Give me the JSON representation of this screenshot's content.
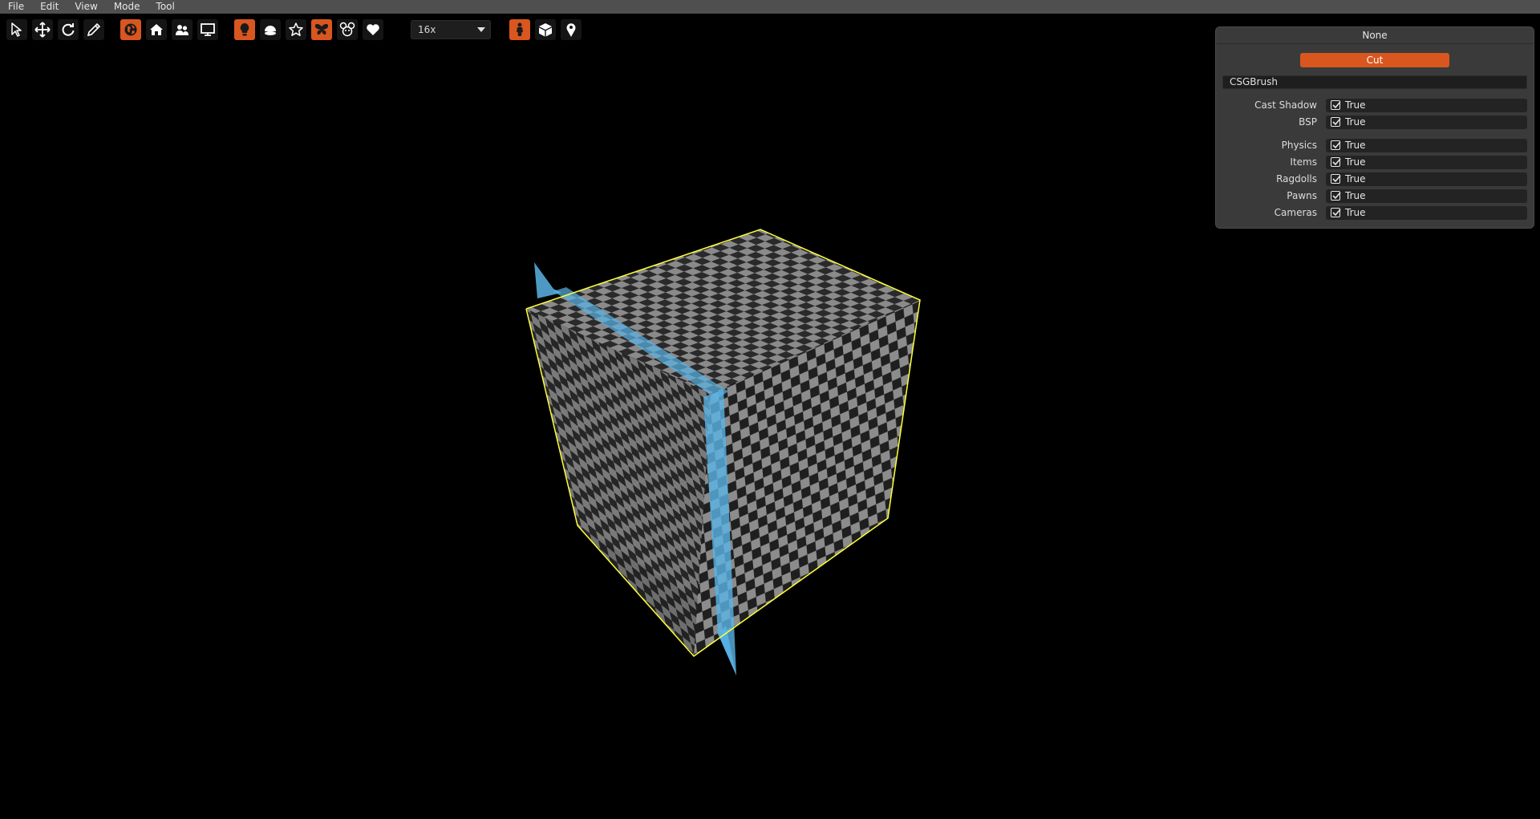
{
  "menu": [
    "File",
    "Edit",
    "View",
    "Mode",
    "Tool"
  ],
  "toolbar": {
    "zoom": "16x",
    "accent_color": "#d9561f"
  },
  "panel": {
    "title": "None",
    "cut_label": "Cut",
    "class_name": "CSGBrush",
    "properties": [
      {
        "label": "Cast Shadow",
        "value": "True",
        "checked": true
      },
      {
        "label": "BSP",
        "value": "True",
        "checked": true
      },
      {
        "label": "Physics",
        "value": "True",
        "checked": true
      },
      {
        "label": "Items",
        "value": "True",
        "checked": true
      },
      {
        "label": "Ragdolls",
        "value": "True",
        "checked": true
      },
      {
        "label": "Pawns",
        "value": "True",
        "checked": true
      },
      {
        "label": "Cameras",
        "value": "True",
        "checked": true
      }
    ]
  },
  "viewport": {
    "selection_outline_color": "#ffff3a",
    "clip_plane_color": "#5ab4e6"
  }
}
